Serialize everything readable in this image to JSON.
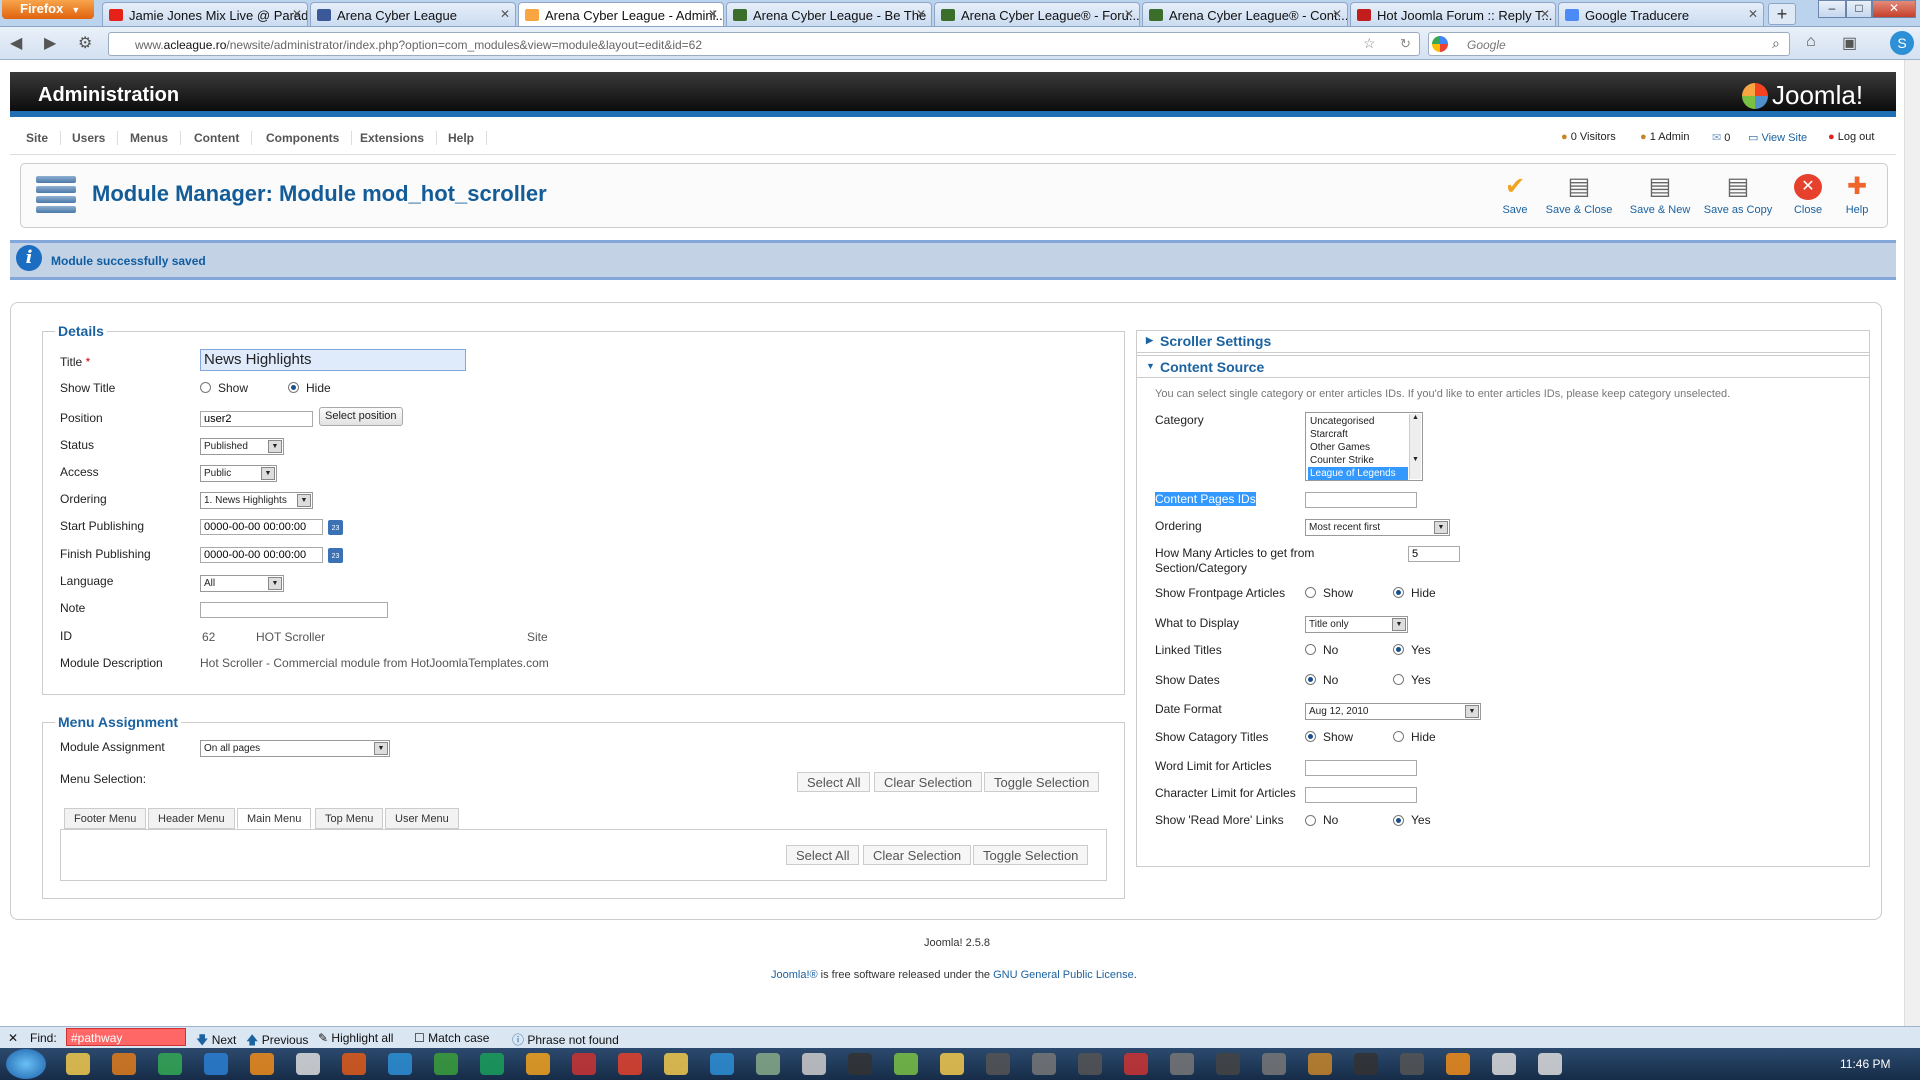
{
  "browser": {
    "menu_label": "Firefox",
    "tabs": [
      {
        "title": "Jamie Jones Mix Live @ Parad...",
        "fav_color": "#e62117"
      },
      {
        "title": "Arena Cyber League",
        "fav_color": "#3b5998"
      },
      {
        "title": "Arena Cyber League - Admini...",
        "fav_color": "#f9a541"
      },
      {
        "title": "Arena Cyber League - Be The ...",
        "fav_color": "#3a6e2a"
      },
      {
        "title": "Arena Cyber League® - Foru...",
        "fav_color": "#3a6e2a"
      },
      {
        "title": "Arena Cyber League® - Cont...",
        "fav_color": "#3a6e2a"
      },
      {
        "title": "Hot Joomla Forum :: Reply T...",
        "fav_color": "#c21d1d"
      },
      {
        "title": "Google Traducere",
        "fav_color": "#4c8bf5"
      }
    ],
    "active_tab": 2,
    "url_prefix": "www.",
    "url_domain": "acleague.ro",
    "url_path": "/newsite/administrator/index.php?option=com_modules&view=module&layout=edit&id=62",
    "search_placeholder": "Google"
  },
  "header": {
    "title": "Administration",
    "brand": "Joomla!"
  },
  "menu": [
    "Site",
    "Users",
    "Menus",
    "Content",
    "Components",
    "Extensions",
    "Help"
  ],
  "status": {
    "visitors": "0 Visitors",
    "admins": "1 Admin",
    "messages": "0",
    "view_site": "View Site",
    "logout": "Log out"
  },
  "toolbar": {
    "page_title": "Module Manager: Module mod_hot_scroller",
    "buttons": [
      "Save",
      "Save & Close",
      "Save & New",
      "Save as Copy",
      "Close",
      "Help"
    ]
  },
  "message": "Module successfully saved",
  "details": {
    "legend": "Details",
    "title_label": "Title",
    "title_value": "News Highlights",
    "show_title_label": "Show Title",
    "show_title_options": [
      "Show",
      "Hide"
    ],
    "show_title_selected": "Hide",
    "position_label": "Position",
    "position_value": "user2",
    "select_position": "Select position",
    "status_label": "Status",
    "status_value": "Published",
    "access_label": "Access",
    "access_value": "Public",
    "ordering_label": "Ordering",
    "ordering_value": "1. News Highlights",
    "start_label": "Start Publishing",
    "start_value": "0000-00-00 00:00:00",
    "finish_label": "Finish Publishing",
    "finish_value": "0000-00-00 00:00:00",
    "calendar_day": "23",
    "language_label": "Language",
    "language_value": "All",
    "note_label": "Note",
    "note_value": "",
    "id_label": "ID",
    "id_value": "62",
    "module_type": "HOT Scroller",
    "client": "Site",
    "desc_label": "Module Description",
    "desc_value": "Hot Scroller - Commercial module from HotJoomlaTemplates.com"
  },
  "menu_assignment": {
    "legend": "Menu Assignment",
    "assignment_label": "Module Assignment",
    "assignment_value": "On all pages",
    "selection_label": "Menu Selection:",
    "select_all": "Select All",
    "clear_selection": "Clear Selection",
    "toggle_selection": "Toggle Selection",
    "tabs": [
      "Footer Menu",
      "Header Menu",
      "Main Menu",
      "Top Menu",
      "User Menu"
    ],
    "active_tab": "Main Menu"
  },
  "scroller_settings": {
    "title": "Scroller Settings"
  },
  "content_source": {
    "title": "Content Source",
    "hint": "You can select single category or enter articles IDs. If you'd like to enter articles IDs, please keep category unselected.",
    "category_label": "Category",
    "categories": [
      "Uncategorised",
      "Starcraft",
      "Other Games",
      "Counter Strike",
      "League of Legends"
    ],
    "category_selected": "League of Legends",
    "page_ids_label": "Content Pages IDs",
    "page_ids_value": "",
    "ordering_label": "Ordering",
    "ordering_value": "Most recent first",
    "how_many_label": "How Many Articles to get from Section/Category",
    "how_many_value": "5",
    "frontpage_label": "Show Frontpage Articles",
    "frontpage_options": [
      "Show",
      "Hide"
    ],
    "frontpage_selected": "Hide",
    "display_label": "What to Display",
    "display_value": "Title only",
    "linked_label": "Linked Titles",
    "linked_options": [
      "No",
      "Yes"
    ],
    "linked_selected": "Yes",
    "dates_label": "Show Dates",
    "dates_options": [
      "No",
      "Yes"
    ],
    "dates_selected": "No",
    "date_format_label": "Date Format",
    "date_format_value": "Aug 12, 2010",
    "cat_titles_label": "Show Catagory Titles",
    "cat_titles_options": [
      "Show",
      "Hide"
    ],
    "cat_titles_selected": "Show",
    "word_limit_label": "Word Limit for Articles",
    "char_limit_label": "Character Limit for Articles",
    "readmore_label": "Show 'Read More' Links",
    "readmore_options": [
      "No",
      "Yes"
    ],
    "readmore_selected": "Yes"
  },
  "footer": {
    "version": "Joomla! 2.5.8",
    "license_pre": "Joomla!®",
    "license_mid": " is free software released under the ",
    "license_link": "GNU General Public License",
    "license_post": "."
  },
  "findbar": {
    "label": "Find:",
    "query": "#pathway",
    "next": "Next",
    "previous": "Previous",
    "highlight": "Highlight all",
    "match_case": "Match case",
    "status": "Phrase not found"
  },
  "taskbar": {
    "clock": "11:46 PM"
  },
  "colors": {
    "accent": "#1b62a0",
    "message_bg": "#c3d2e5",
    "admin_bar": "#0c0c0c"
  }
}
